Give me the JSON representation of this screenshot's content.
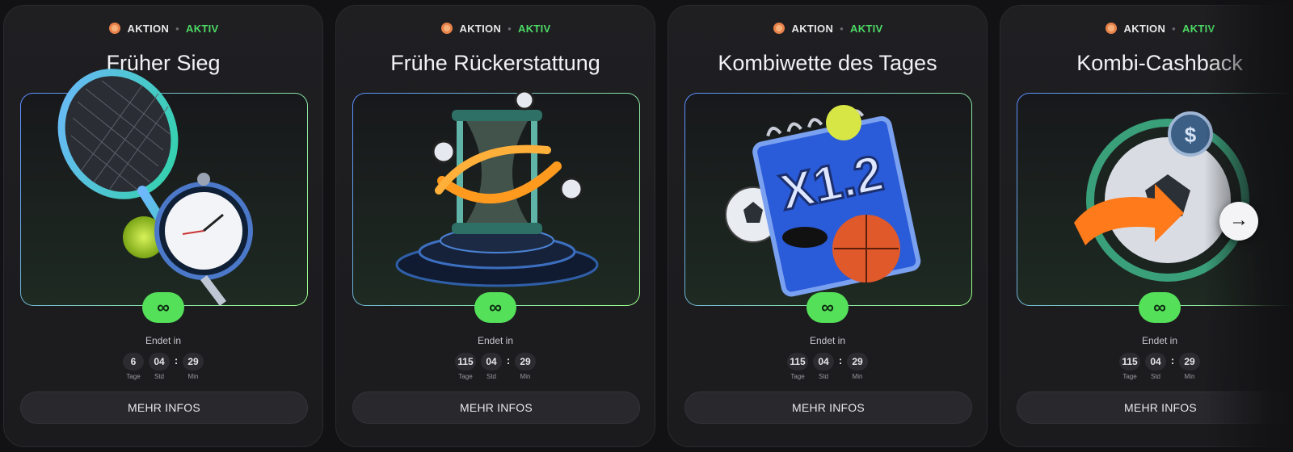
{
  "cards": [
    {
      "tag": "AKTION",
      "status": "AKTIV",
      "title": "Früher Sieg",
      "badge": "∞",
      "ends_label": "Endet in",
      "timer": [
        {
          "value": "6",
          "label": "Tage"
        },
        {
          "value": "04",
          "label": "Std"
        },
        {
          "value": "29",
          "label": "Min"
        }
      ],
      "button": "MEHR INFOS",
      "art": "tennis-racket-stopwatch"
    },
    {
      "tag": "AKTION",
      "status": "AKTIV",
      "title": "Frühe Rückerstattung",
      "badge": "∞",
      "ends_label": "Endet in",
      "timer": [
        {
          "value": "115",
          "label": "Tage"
        },
        {
          "value": "04",
          "label": "Std"
        },
        {
          "value": "29",
          "label": "Min"
        }
      ],
      "button": "MEHR INFOS",
      "art": "hourglass"
    },
    {
      "tag": "AKTION",
      "status": "AKTIV",
      "title": "Kombiwette des Tages",
      "badge": "∞",
      "ends_label": "Endet in",
      "timer": [
        {
          "value": "115",
          "label": "Tage"
        },
        {
          "value": "04",
          "label": "Std"
        },
        {
          "value": "29",
          "label": "Min"
        }
      ],
      "button": "MEHR INFOS",
      "art": "notepad-x1.2",
      "art_text": "X1.2"
    },
    {
      "tag": "AKTION",
      "status": "AKTIV",
      "title": "Kombi-Cashback",
      "badge": "∞",
      "ends_label": "Endet in",
      "timer": [
        {
          "value": "115",
          "label": "Tage"
        },
        {
          "value": "04",
          "label": "Std"
        },
        {
          "value": "29",
          "label": "Min"
        }
      ],
      "button": "MEHR INFOS",
      "art": "soccer-cashback"
    }
  ],
  "next_arrow": "→",
  "colors": {
    "accent_green": "#55e05a",
    "status_green": "#4cd964",
    "card_bg": "#1f1f22"
  }
}
